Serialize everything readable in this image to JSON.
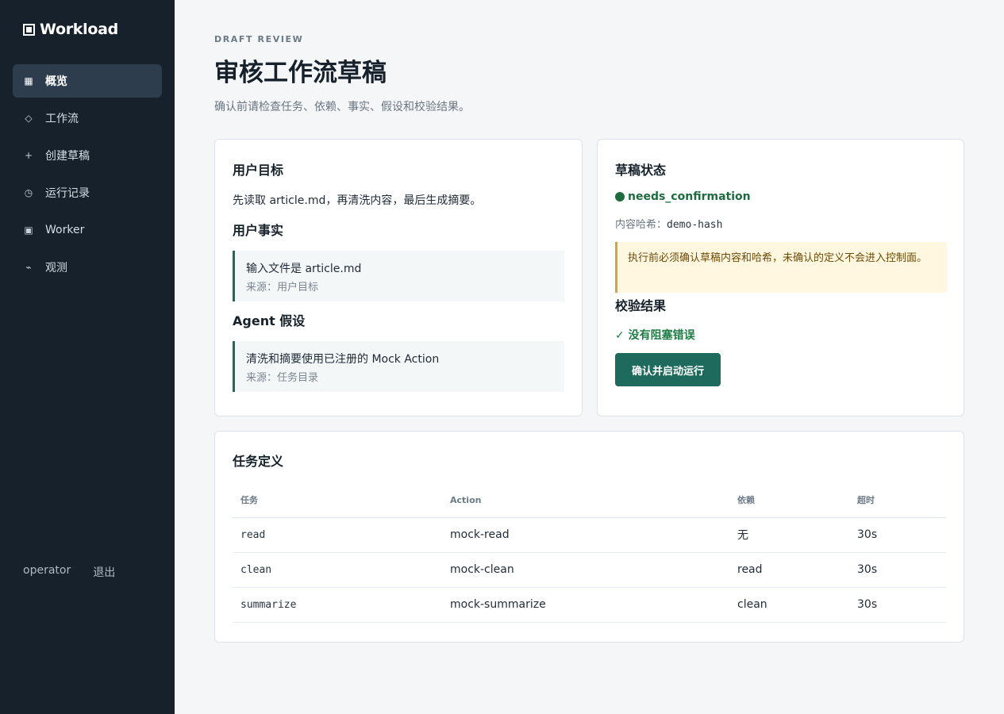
{
  "brand": {
    "name": "Workload",
    "icon": "window-icon"
  },
  "nav": [
    {
      "label": "概览",
      "icon": "grid-icon",
      "glyph": "▦",
      "active": true
    },
    {
      "label": "工作流",
      "icon": "diamond-icon",
      "glyph": "◇",
      "active": false
    },
    {
      "label": "创建草稿",
      "icon": "plus-icon",
      "glyph": "+",
      "active": false
    },
    {
      "label": "运行记录",
      "icon": "clock-icon",
      "glyph": "◷",
      "active": false
    },
    {
      "label": "Worker",
      "icon": "server-icon",
      "glyph": "▣",
      "active": false
    },
    {
      "label": "观测",
      "icon": "pulse-icon",
      "glyph": "⌁",
      "active": false
    }
  ],
  "footer": {
    "user": "operator",
    "logout": "退出"
  },
  "page": {
    "eyebrow": "DRAFT REVIEW",
    "title": "审核工作流草稿",
    "subtitle": "确认前请检查任务、依赖、事实、假设和校验结果。"
  },
  "goal": {
    "heading": "用户目标",
    "text": "先读取 article.md，再清洗内容，最后生成摘要。"
  },
  "facts": {
    "heading": "用户事实",
    "items": [
      {
        "text": "输入文件是 article.md",
        "source": "来源：用户目标"
      }
    ]
  },
  "assumptions": {
    "heading": "Agent 假设",
    "items": [
      {
        "text": "清洗和摘要使用已注册的 Mock Action",
        "source": "来源：任务目录"
      }
    ]
  },
  "draft": {
    "heading": "草稿状态",
    "status": "needs_confirmation",
    "hash_label": "内容哈希：",
    "hash_value": "demo-hash",
    "warning": "执行前必须确认草稿内容和哈希，未确认的定义不会进入控制面。",
    "status_color": "#1e6b3f"
  },
  "validation": {
    "heading": "校验结果",
    "result": "✓ 没有阻塞错误",
    "button": "确认并启动运行"
  },
  "tasks": {
    "heading": "任务定义",
    "columns": [
      "任务",
      "Action",
      "依赖",
      "超时"
    ],
    "rows": [
      [
        "read",
        "mock-read",
        "无",
        "30s"
      ],
      [
        "clean",
        "mock-clean",
        "read",
        "30s"
      ],
      [
        "summarize",
        "mock-summarize",
        "clean",
        "30s"
      ]
    ]
  },
  "colors": {
    "sidebar": "#17212b",
    "accent": "#1e6b5d",
    "warning_bg": "#fff7e0",
    "warning_border": "#d5a43a"
  }
}
